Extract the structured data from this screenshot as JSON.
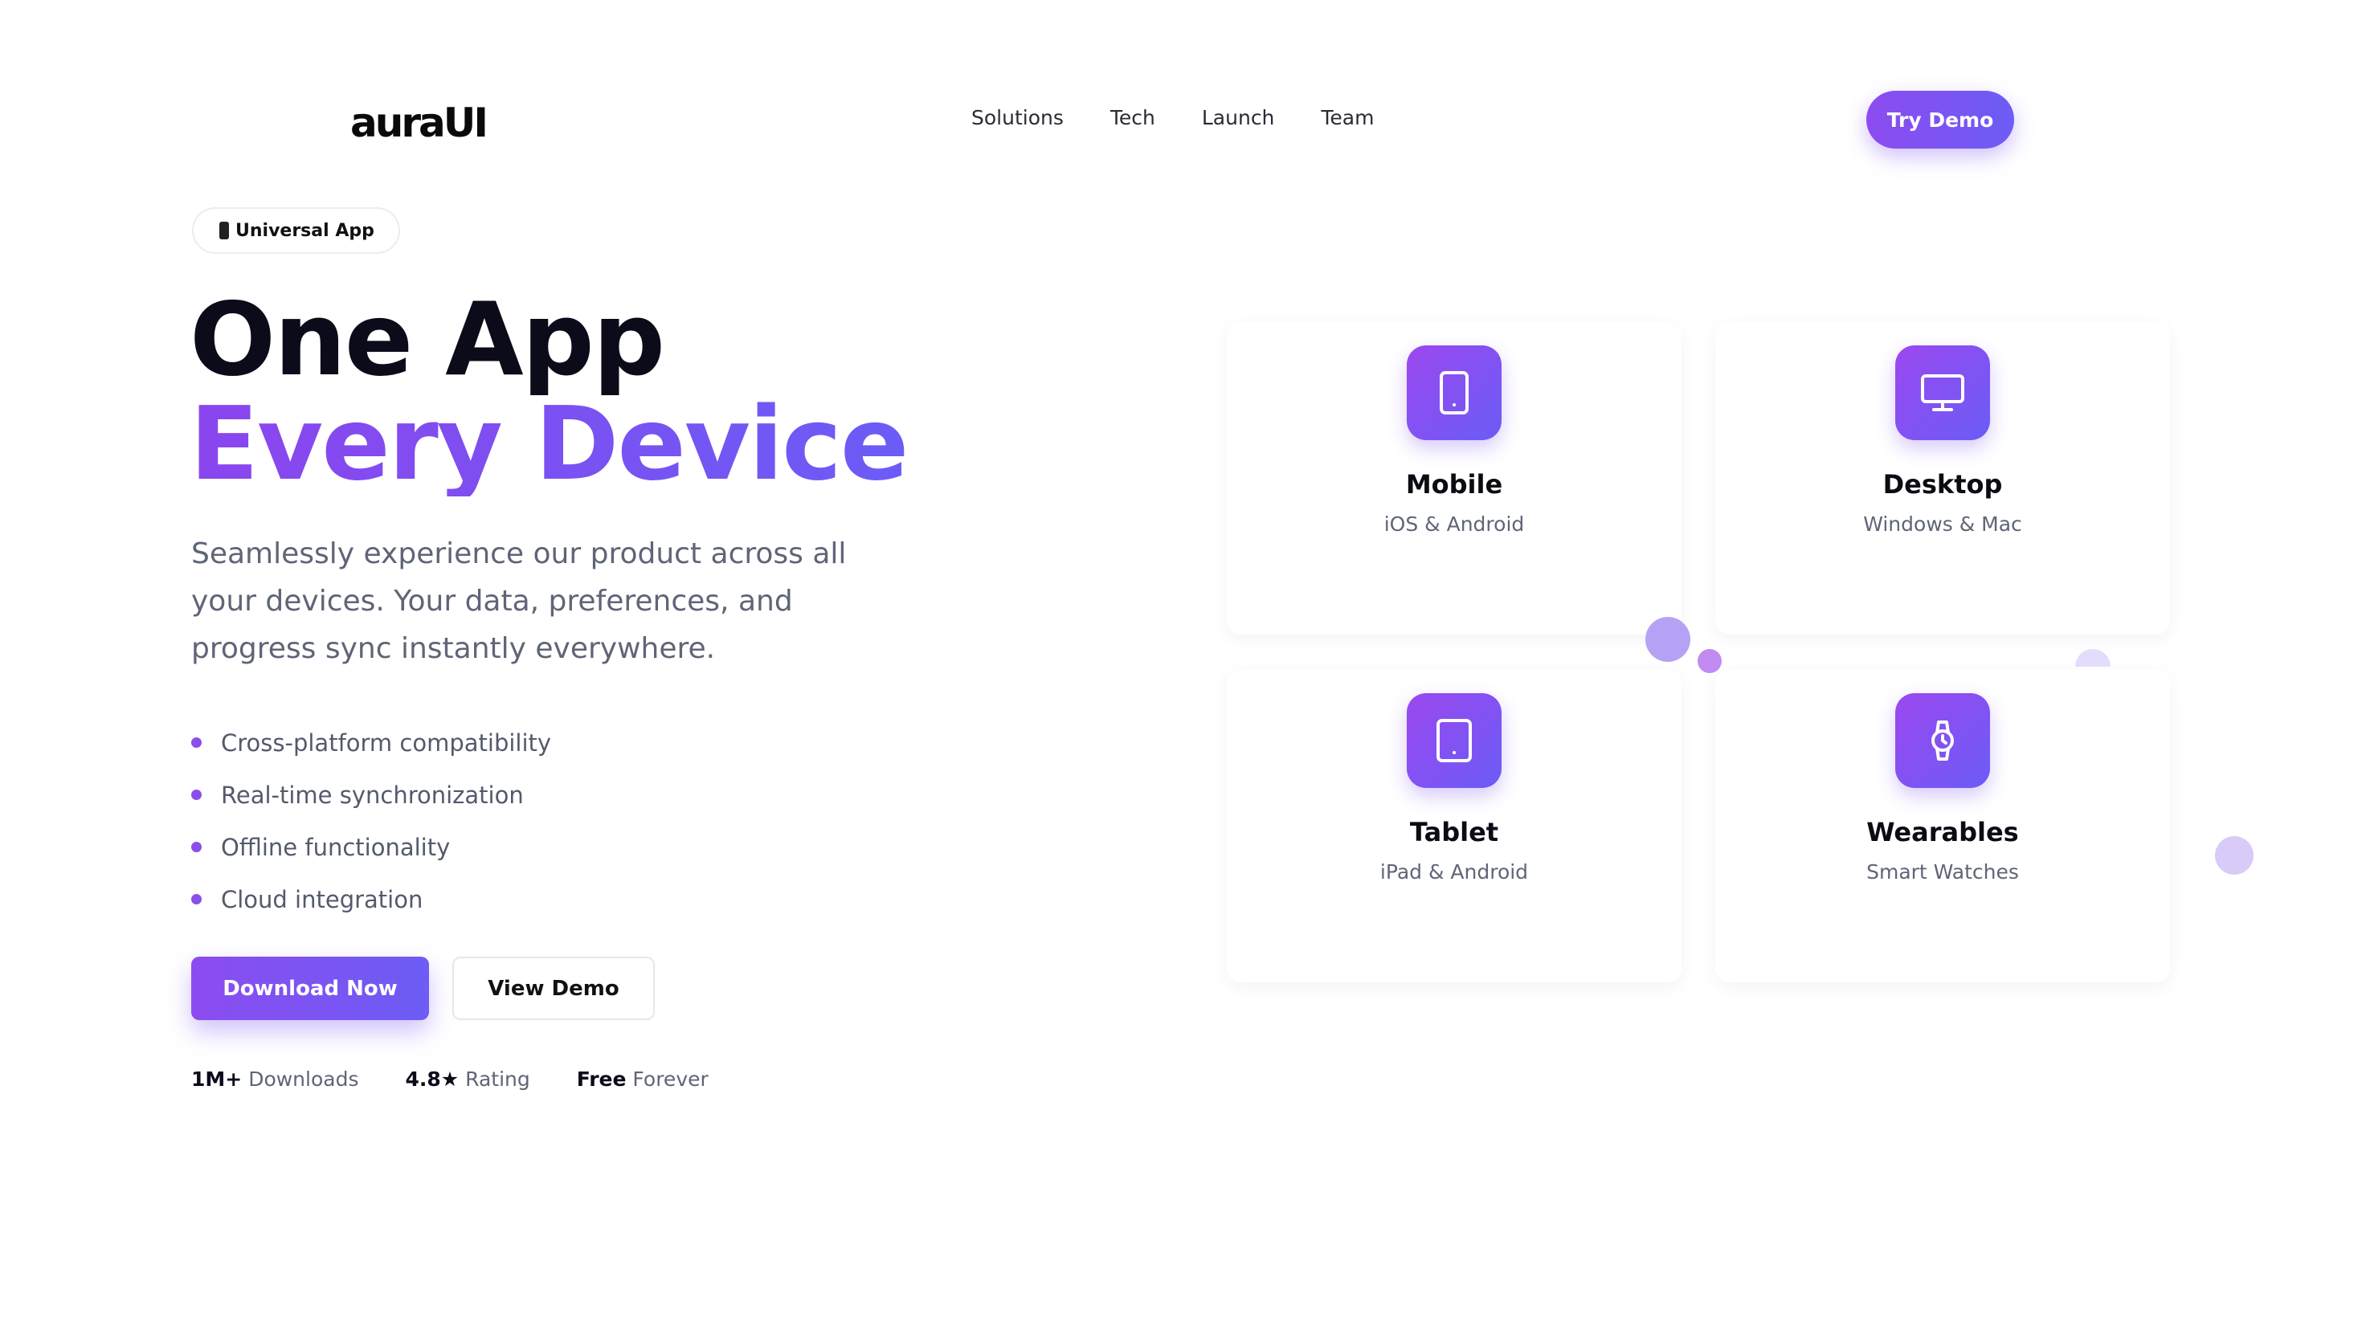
{
  "brand": {
    "logo": "auraUI"
  },
  "nav": {
    "links": [
      "Solutions",
      "Tech",
      "Launch",
      "Team"
    ],
    "cta": "Try Demo"
  },
  "hero": {
    "badge": "Universal App",
    "title_line1": "One App",
    "title_line2": "Every Device",
    "lead": "Seamlessly experience our product across all your devices. Your data, preferences, and progress sync instantly everywhere.",
    "features": [
      "Cross-platform compatibility",
      "Real-time synchronization",
      "Offline functionality",
      "Cloud integration"
    ],
    "primary_button": "Download Now",
    "secondary_button": "View Demo",
    "stats": [
      {
        "value": "1M+",
        "label": "Downloads"
      },
      {
        "value": "4.8★",
        "label": "Rating"
      },
      {
        "value": "Free",
        "label": "Forever"
      }
    ]
  },
  "devices": [
    {
      "title": "Mobile",
      "subtitle": "iOS & Android",
      "icon": "smartphone-icon"
    },
    {
      "title": "Desktop",
      "subtitle": "Windows & Mac",
      "icon": "monitor-icon"
    },
    {
      "title": "Tablet",
      "subtitle": "iPad & Android",
      "icon": "tablet-icon"
    },
    {
      "title": "Wearables",
      "subtitle": "Smart Watches",
      "icon": "watch-icon"
    }
  ],
  "colors": {
    "accent_start": "#8b4cf0",
    "accent_end": "#6d5cf5",
    "heading": "#0b0b1a",
    "body_text": "#5f6577"
  }
}
